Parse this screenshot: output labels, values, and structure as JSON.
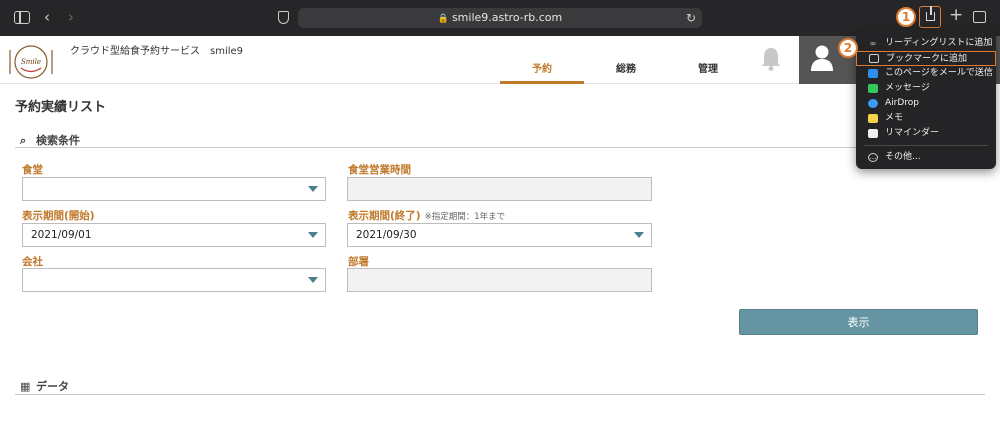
{
  "browser": {
    "url": "smile9.astro-rb.com",
    "step1": "1",
    "step2": "2"
  },
  "header": {
    "title": "クラウド型給食予約サービス　smile9",
    "logo_text": "Smile",
    "tabs": [
      {
        "label": "予約"
      },
      {
        "label": "総務"
      },
      {
        "label": "管理"
      }
    ]
  },
  "page": {
    "title": "予約実績リスト",
    "search_section": "検索条件",
    "data_section": "データ",
    "fields": {
      "cafeteria": {
        "label": "食堂",
        "value": ""
      },
      "business_hours": {
        "label": "食堂営業時間",
        "value": ""
      },
      "period_start": {
        "label": "表示期間(開始)",
        "value": "2021/09/01"
      },
      "period_end": {
        "label": "表示期間(終了)",
        "note": "※指定期間：1年まで",
        "value": "2021/09/30"
      },
      "company": {
        "label": "会社",
        "value": ""
      },
      "department": {
        "label": "部署",
        "value": ""
      }
    },
    "show_button": "表示"
  },
  "share_menu": {
    "items": [
      {
        "label": "リーディングリストに追加",
        "icon": "reading-list-icon"
      },
      {
        "label": "ブックマークに追加",
        "icon": "bookmark-icon",
        "highlighted": true
      },
      {
        "label": "このページをメールで送信",
        "icon": "mail-icon"
      },
      {
        "label": "メッセージ",
        "icon": "messages-icon"
      },
      {
        "label": "AirDrop",
        "icon": "airdrop-icon"
      },
      {
        "label": "メモ",
        "icon": "notes-icon"
      },
      {
        "label": "リマインダー",
        "icon": "reminders-icon"
      },
      {
        "label": "その他...",
        "icon": "more-icon"
      }
    ]
  },
  "colors": {
    "accent": "#c0792b",
    "annotation": "#e07a2e",
    "button": "#6594a3",
    "arrow": "#4a7f8e"
  }
}
